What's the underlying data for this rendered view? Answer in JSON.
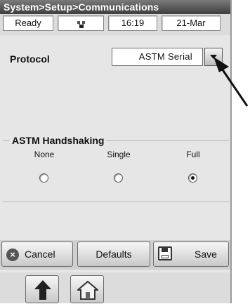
{
  "title": "System>Setup>Communications",
  "status": {
    "state": "Ready",
    "icon": "network-icon",
    "time": "16:19",
    "date": "21-Mar"
  },
  "protocol": {
    "label": "Protocol",
    "value": "ASTM Serial"
  },
  "handshaking": {
    "legend": "ASTM Handshaking",
    "options": [
      {
        "label": "None",
        "selected": false
      },
      {
        "label": "Single",
        "selected": false
      },
      {
        "label": "Full",
        "selected": true
      }
    ]
  },
  "buttons": {
    "cancel": "Cancel",
    "defaults": "Defaults",
    "save": "Save"
  },
  "nav": {
    "up_icon": "up-arrow-icon",
    "home_icon": "home-icon"
  }
}
